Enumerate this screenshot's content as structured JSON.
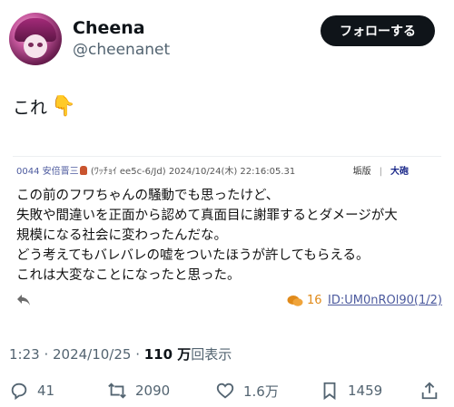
{
  "user": {
    "display_name": "Cheena",
    "handle": "@cheenanet",
    "follow_label": "フォローする"
  },
  "tweet": {
    "text": "これ",
    "emoji": "👇"
  },
  "quote": {
    "meta_no": "0044",
    "meta_name": "安倍晋三",
    "meta_id": "(ﾜｯﾁｮｲ ee5c-6/Jd)",
    "meta_date": "2024/10/24(木) 22:16:05.31",
    "board": "垢版",
    "sep": "|",
    "daiho": "大砲",
    "lines": [
      "この前のフワちゃんの騒動でも思ったけど、",
      "失敗や間違いを正面から認めて真面目に謝罪するとダメージが大",
      "規模になる社会に変わったんだな。",
      "どう考えてもバレバレの嘘をついたほうが許してもらえる。",
      "これは大変なことになったと思った。"
    ],
    "reply_count": "16",
    "id_link": "ID:UM0nROl90(1/2)"
  },
  "timestamp": {
    "time_date": "1:23 · 2024/10/25 · ",
    "views_num": "110 万",
    "views_label": "回表示"
  },
  "actions": {
    "replies": "41",
    "retweets": "2090",
    "likes": "1.6万",
    "bookmarks": "1459"
  },
  "colors": {
    "text": "#0f1419",
    "muted": "#536471",
    "button_bg": "#0f1419",
    "quote_link": "#4c5a9e",
    "quote_count": "#e08a1a"
  }
}
